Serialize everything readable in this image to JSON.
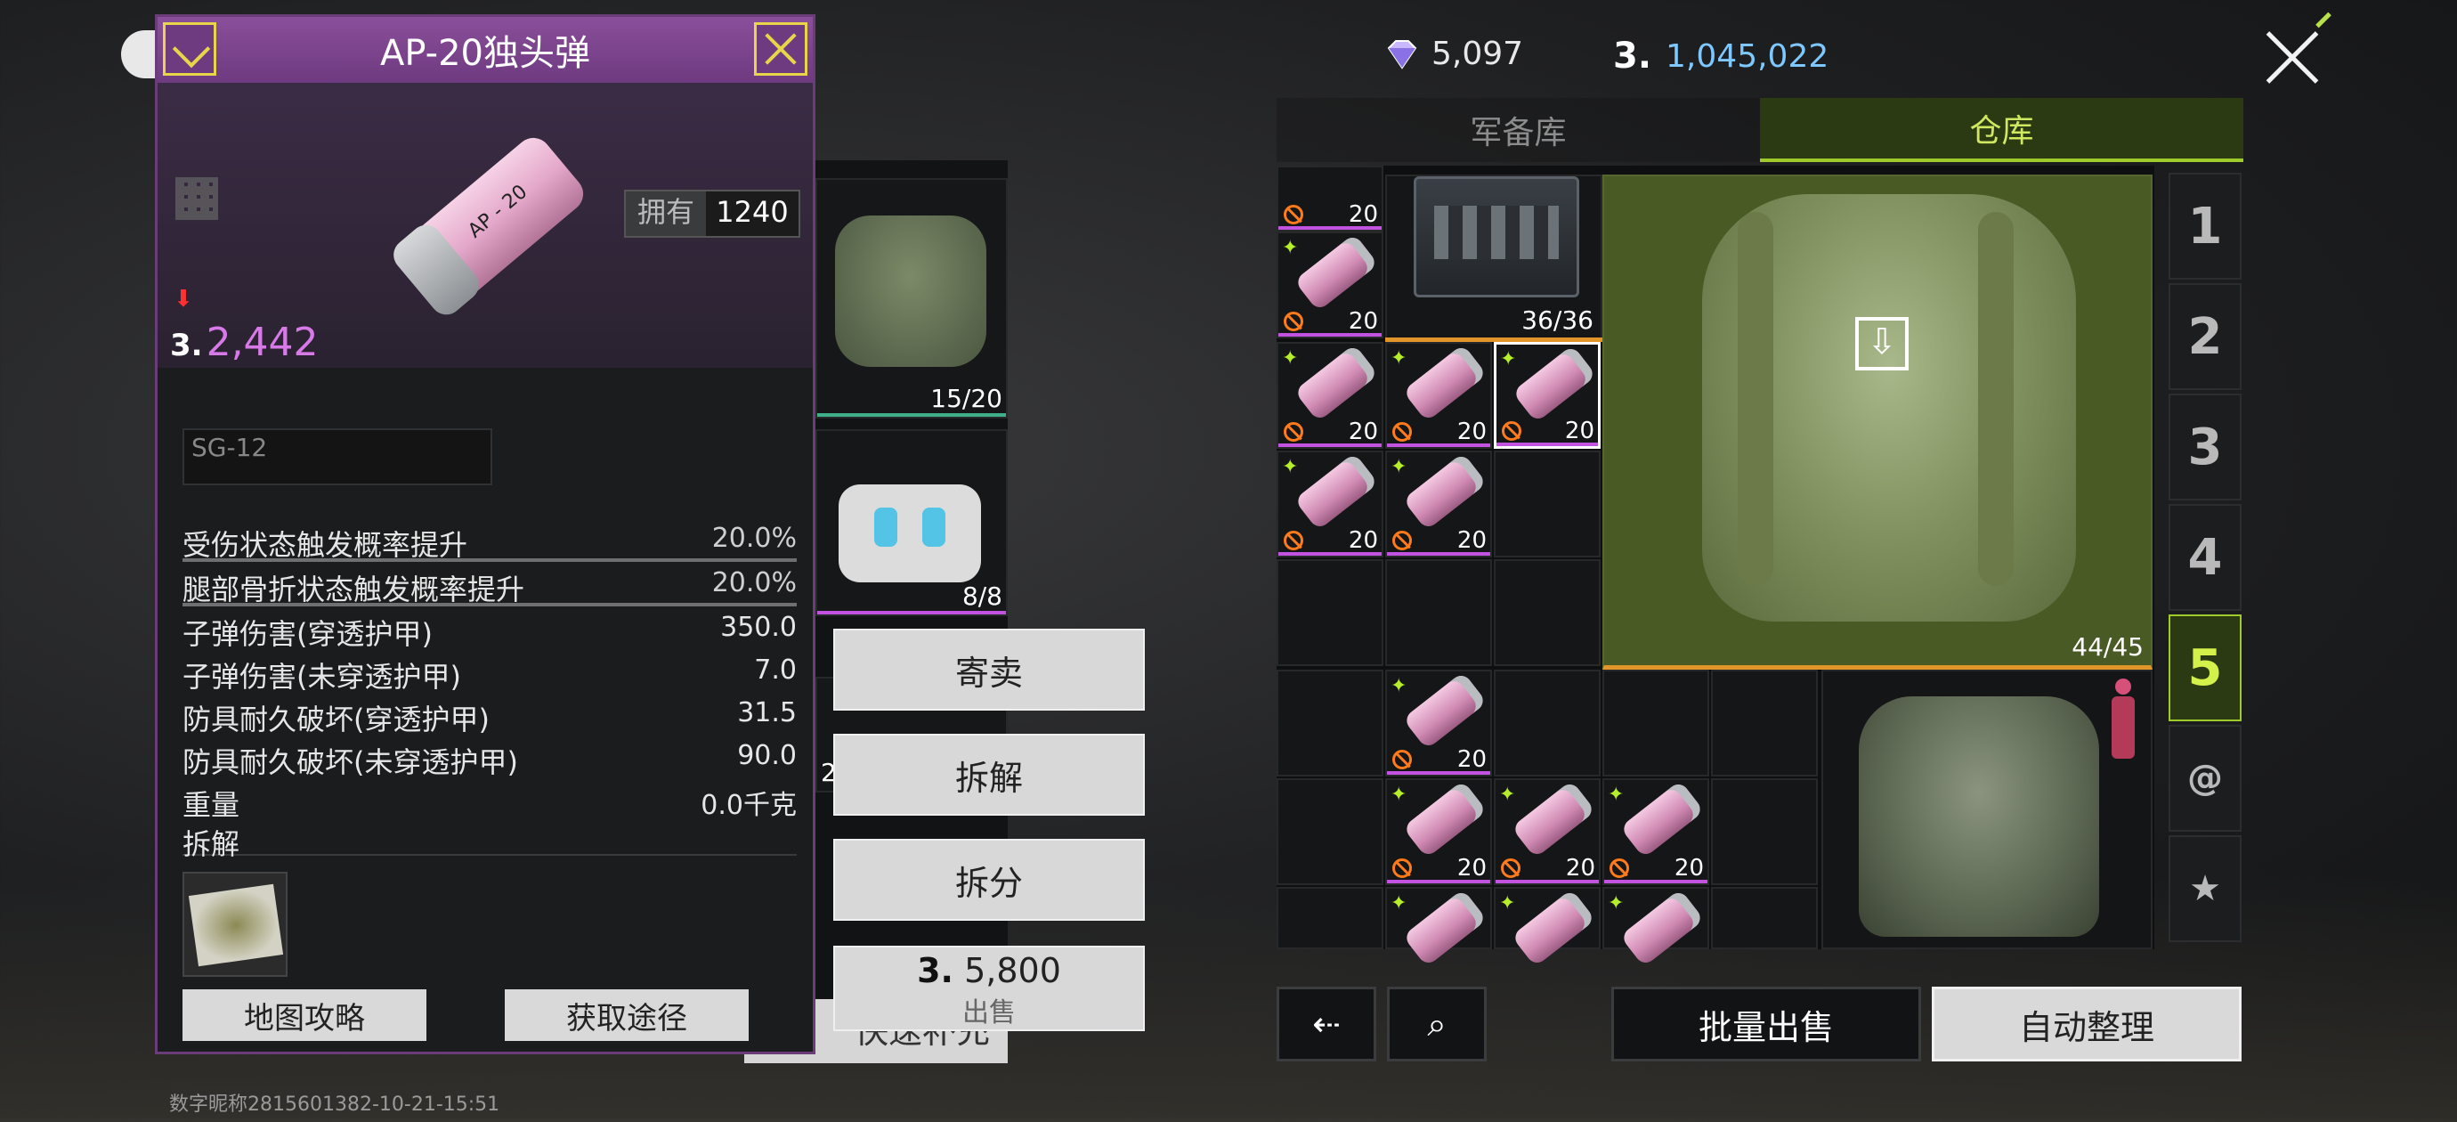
{
  "currency": {
    "gems": "5,097",
    "coin_symbol": "3.",
    "coins": "1,045,022"
  },
  "tabs": [
    {
      "label": "军备库",
      "active": false
    },
    {
      "label": "仓库",
      "active": true
    }
  ],
  "side_tabs": [
    "1",
    "2",
    "3",
    "4",
    "5"
  ],
  "grid": {
    "backpack_count": "44/45",
    "crate_count": "36/36",
    "ammo_count": "20"
  },
  "equipment": {
    "vest_count": "15/20",
    "robot_count": "8/8",
    "partial_count": "2"
  },
  "actions": {
    "consign": "寄卖",
    "dismantle": "拆解",
    "split": "拆分",
    "sell_price": "5,800",
    "sell_label": "出售"
  },
  "bottom": {
    "batch_sell": "批量出售",
    "auto_sort": "自动整理",
    "behind_label": "快速补充"
  },
  "item": {
    "name": "AP-20独头弹",
    "owned_label": "拥有",
    "owned_value": "1240",
    "price": "2,442",
    "shell_text": "AP - 20",
    "weapon": "SG-12",
    "stats": [
      {
        "label": "受伤状态触发概率提升",
        "value": "20.0%"
      },
      {
        "label": "腿部骨折状态触发概率提升",
        "value": "20.0%"
      },
      {
        "label": "子弹伤害(穿透护甲)",
        "value": "350.0"
      },
      {
        "label": "子弹伤害(未穿透护甲)",
        "value": "7.0"
      },
      {
        "label": "防具耐久破坏(穿透护甲)",
        "value": "31.5"
      },
      {
        "label": "防具耐久破坏(未穿透护甲)",
        "value": "90.0"
      },
      {
        "label": "重量",
        "value": "0.0千克"
      }
    ],
    "dismantle_label": "拆解",
    "map_guide": "地图攻略",
    "obtain": "获取途径"
  },
  "watermark": "数字昵称2815601382-10-21-15:51",
  "colors": {
    "accent_green": "#9fca2c",
    "panel_purple": "#6e3a80",
    "rarity_purple": "#c253e0",
    "price_purple": "#d77ae8",
    "coin_blue": "#7fc8ff"
  }
}
